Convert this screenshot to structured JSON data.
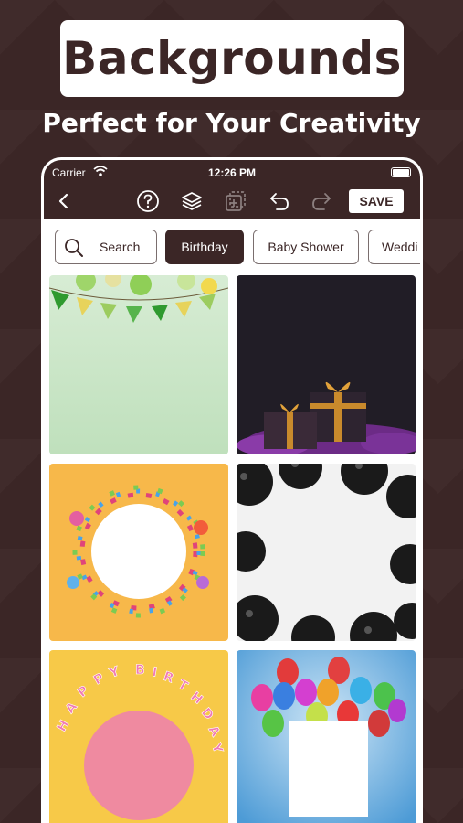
{
  "promo": {
    "title": "Backgrounds",
    "subtitle": "Perfect for Your Creativity"
  },
  "status_bar": {
    "carrier": "Carrier",
    "time": "12:26 PM"
  },
  "toolbar": {
    "save_label": "SAVE",
    "icons": [
      "back-icon",
      "help-icon",
      "layers-icon",
      "add-frame-icon",
      "undo-icon",
      "redo-icon"
    ]
  },
  "categories": {
    "search_label": "Search",
    "items": [
      "Birthday",
      "Baby Shower",
      "Wedding"
    ],
    "visible_items": [
      "Birthday",
      "Baby Shower",
      "Weddi"
    ],
    "selected": "Birthday"
  },
  "grid": {
    "tiles": [
      {
        "name": "bunting-green-background"
      },
      {
        "name": "gift-boxes-dark-background"
      },
      {
        "name": "candy-circle-orange-background"
      },
      {
        "name": "black-balloons-white-background"
      },
      {
        "name": "happy-birthday-yellow-background"
      },
      {
        "name": "balloons-blue-background"
      }
    ]
  },
  "colors": {
    "brand": "#3b2626",
    "white": "#ffffff"
  }
}
